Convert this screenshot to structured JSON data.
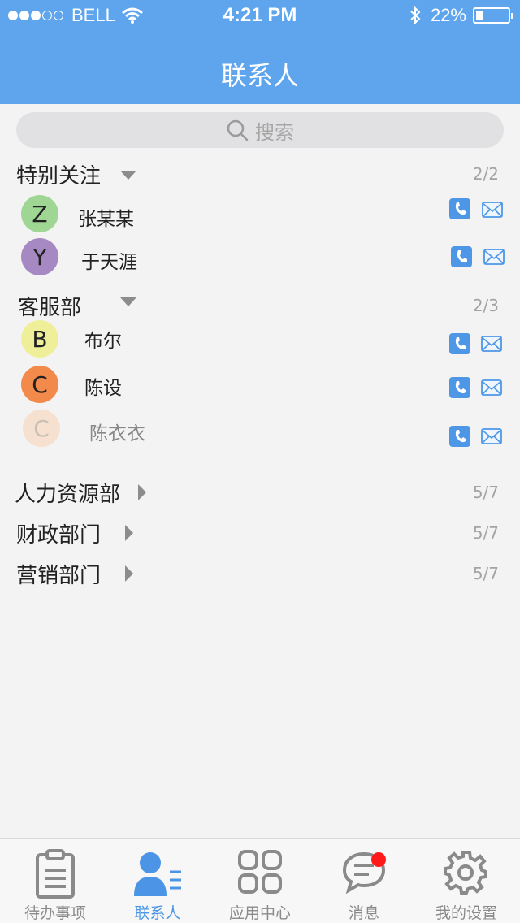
{
  "status_bar": {
    "carrier": "BELL",
    "time": "4:21 PM",
    "battery_text": "22%",
    "battery_level": 0.22,
    "signal_filled": 3,
    "signal_total": 5
  },
  "header": {
    "title": "联系人"
  },
  "search": {
    "placeholder": "搜索"
  },
  "groups": [
    {
      "name": "特别关注",
      "count": "2/2",
      "expanded": true,
      "contacts": [
        {
          "initial": "Z",
          "name": "张某某",
          "color": "#9fd694"
        },
        {
          "initial": "Y",
          "name": "于天涯",
          "color": "#a689c2"
        }
      ]
    },
    {
      "name": "客服部",
      "count": "2/3",
      "expanded": true,
      "contacts": [
        {
          "initial": "B",
          "name": "布尔",
          "color": "#efef9a"
        },
        {
          "initial": "C",
          "name": "陈设",
          "color": "#f18a4a"
        },
        {
          "initial": "C",
          "name": "陈衣衣",
          "color": "#f6e0cf",
          "faded": true
        }
      ]
    },
    {
      "name": "人力资源部",
      "count": "5/7",
      "expanded": false
    },
    {
      "name": "财政部门",
      "count": "5/7",
      "expanded": false
    },
    {
      "name": "营销部门",
      "count": "5/7",
      "expanded": false
    }
  ],
  "tabs": [
    {
      "label": "待办事项",
      "icon": "clipboard-icon"
    },
    {
      "label": "联系人",
      "icon": "contacts-icon",
      "active": true
    },
    {
      "label": "应用中心",
      "icon": "app-grid-icon"
    },
    {
      "label": "消息",
      "icon": "message-icon",
      "badge": true
    },
    {
      "label": "我的设置",
      "icon": "gear-icon"
    }
  ],
  "colors": {
    "header": "#5ea5ee",
    "accent": "#4c95e6",
    "phone_button": "#4e97e7",
    "badge": "#ff1a1a"
  }
}
